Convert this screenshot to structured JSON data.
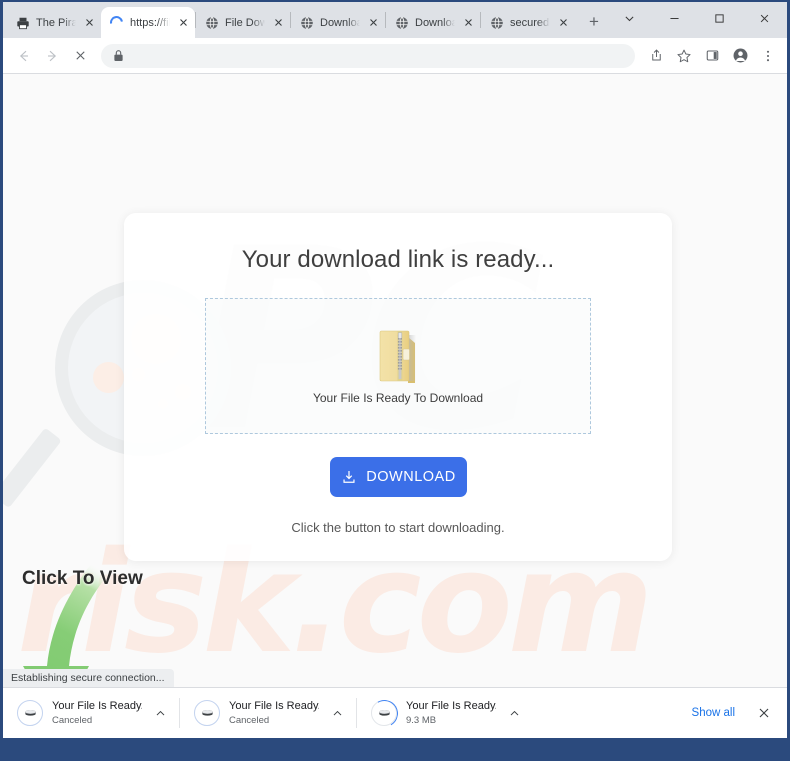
{
  "window": {
    "controls": [
      {
        "name": "tab-search",
        "glyph": "⌄"
      },
      {
        "name": "minimize",
        "glyph": "–"
      },
      {
        "name": "maximize",
        "glyph": "◻"
      },
      {
        "name": "close",
        "glyph": "✕"
      }
    ]
  },
  "tabs": [
    {
      "title": "The Pirate",
      "favicon": "printer-icon",
      "active": false
    },
    {
      "title": "https://file",
      "favicon": "loading-spinner-icon",
      "active": true
    },
    {
      "title": "File Downlo",
      "favicon": "globe-icon",
      "active": false
    },
    {
      "title": "Download",
      "favicon": "globe-icon",
      "active": false
    },
    {
      "title": "Download",
      "favicon": "globe-icon",
      "active": false
    },
    {
      "title": "securedo",
      "favicon": "globe-icon",
      "active": false
    }
  ],
  "newtab_label": "+",
  "toolbar": {
    "back_label": "←",
    "forward_label": "→",
    "stop_label": "✕",
    "url": "",
    "url_placeholder": "",
    "lock_icon": "lock-icon",
    "share_icon": "share-icon",
    "bookmark_icon": "star-icon",
    "sidepanel_icon": "side-panel-icon",
    "profile_icon": "profile-avatar-icon",
    "menu_icon": "three-dot-menu-icon"
  },
  "page": {
    "card_title": "Your download link is ready...",
    "dropzone_label": "Your File Is Ready To Download",
    "zip_icon": "zip-folder-icon",
    "download_button_label": "DOWNLOAD",
    "download_button_icon": "download-tray-icon",
    "download_button_color": "#3b6fe8",
    "hint": "Click the button to start downloading.",
    "annotation": "Click To View",
    "annotation_arrow_color": "#84cc75",
    "watermark_primary": "PC",
    "watermark_secondary": "risk.com",
    "watermark_primary_color": "#e9eaeb",
    "watermark_secondary_color": "#fbebe4",
    "status_text": "Establishing secure connection..."
  },
  "shelf": {
    "items": [
      {
        "name": "Your File Is Ready....vhd",
        "status": "Canceled",
        "icon": "vhd-file-icon",
        "menu_label": "⌃",
        "progress": "none"
      },
      {
        "name": "Your File Is Ready....vhd",
        "status": "Canceled",
        "icon": "vhd-file-icon",
        "menu_label": "⌃",
        "progress": "none"
      },
      {
        "name": "Your File Is Ready....vhd",
        "status": "9.3 MB",
        "icon": "vhd-file-icon",
        "menu_label": "⌃",
        "progress": "partial"
      }
    ],
    "show_all_label": "Show all",
    "close_label": "✕"
  }
}
